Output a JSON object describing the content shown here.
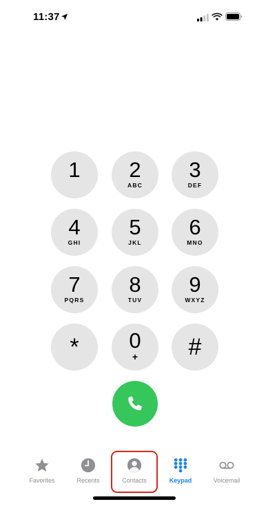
{
  "status_bar": {
    "time": "11:37",
    "icons": [
      "location-arrow-icon",
      "cellular-signal-icon",
      "wifi-icon",
      "battery-icon"
    ]
  },
  "keypad": {
    "keys": [
      {
        "digit": "1",
        "letters": ""
      },
      {
        "digit": "2",
        "letters": "ABC"
      },
      {
        "digit": "3",
        "letters": "DEF"
      },
      {
        "digit": "4",
        "letters": "GHI"
      },
      {
        "digit": "5",
        "letters": "JKL"
      },
      {
        "digit": "6",
        "letters": "MNO"
      },
      {
        "digit": "7",
        "letters": "PQRS"
      },
      {
        "digit": "8",
        "letters": "TUV"
      },
      {
        "digit": "9",
        "letters": "WXYZ"
      },
      {
        "digit": "*",
        "letters": ""
      },
      {
        "digit": "0",
        "letters": "+"
      },
      {
        "digit": "#",
        "letters": ""
      }
    ],
    "call_icon": "phone-icon"
  },
  "tab_bar": {
    "tabs": [
      {
        "label": "Favorites",
        "icon": "star-icon",
        "active": false
      },
      {
        "label": "Recents",
        "icon": "clock-icon",
        "active": false
      },
      {
        "label": "Contacts",
        "icon": "person-circle-icon",
        "active": false
      },
      {
        "label": "Keypad",
        "icon": "keypad-grid-icon",
        "active": true
      },
      {
        "label": "Voicemail",
        "icon": "voicemail-icon",
        "active": false
      }
    ],
    "highlighted_tab": "Contacts"
  },
  "colors": {
    "key_background": "#e5e5e6",
    "call_green": "#35c759",
    "active_tab": "#1a82f7",
    "inactive_tab": "#8e8e93",
    "highlight_red": "#d9261c"
  }
}
